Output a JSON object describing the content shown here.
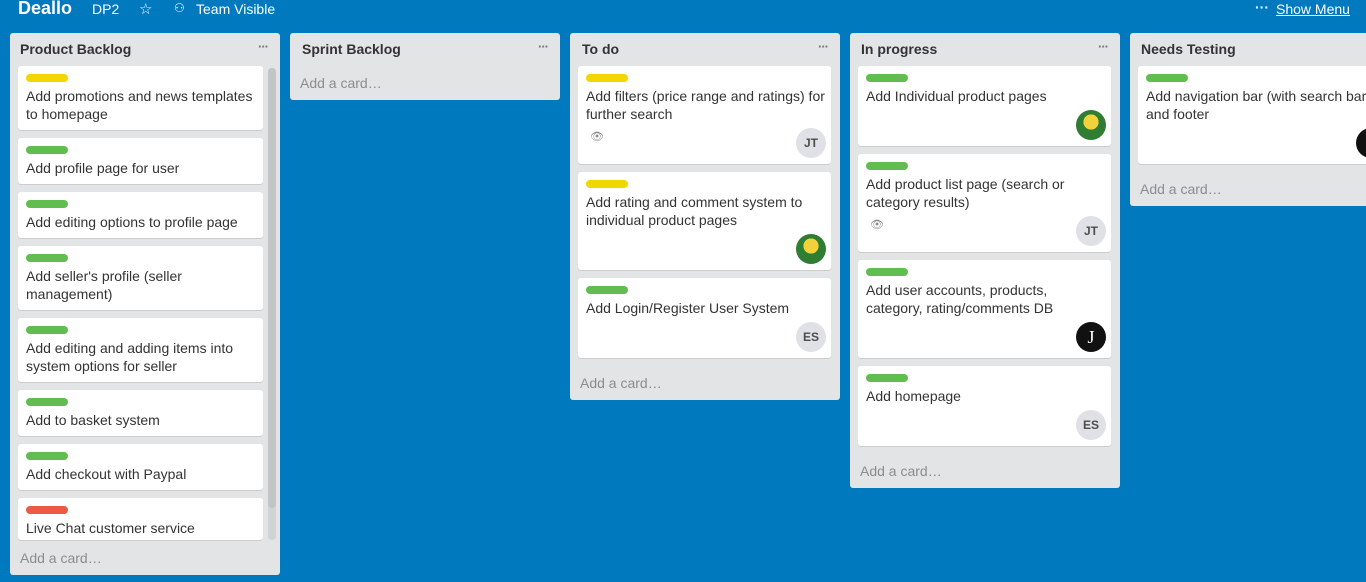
{
  "header": {
    "board_name": "Deallo",
    "board_tag": "DP2",
    "visibility": "Team Visible",
    "show_menu": "Show Menu"
  },
  "colors": {
    "green": "#61bd4f",
    "yellow": "#f2d600",
    "red": "#eb5a46"
  },
  "lists": [
    {
      "title": "Product Backlog",
      "add_card": "Add a card…",
      "cards": [
        {
          "label": "yellow",
          "title": "Add promotions and news templates to homepage"
        },
        {
          "label": "green",
          "title": "Add profile page for user"
        },
        {
          "label": "green",
          "title": "Add editing options to profile page"
        },
        {
          "label": "green",
          "title": "Add seller's profile (seller management)"
        },
        {
          "label": "green",
          "title": "Add editing and adding items into system options for seller"
        },
        {
          "label": "green",
          "title": "Add to basket system"
        },
        {
          "label": "green",
          "title": "Add checkout with Paypal"
        },
        {
          "label": "red",
          "title": "Live Chat customer service"
        }
      ]
    },
    {
      "title": "Sprint Backlog",
      "add_card": "Add a card…",
      "cards": []
    },
    {
      "title": "To do",
      "add_card": "Add a card…",
      "cards": [
        {
          "label": "yellow",
          "title": "Add filters (price range and ratings) for further search",
          "watch": true,
          "member": "JT"
        },
        {
          "label": "yellow",
          "title": "Add rating and comment system to individual product pages",
          "member_icon": "photo-avatar"
        },
        {
          "label": "green",
          "title": "Add Login/Register User System",
          "member": "ES"
        }
      ]
    },
    {
      "title": "In progress",
      "add_card": "Add a card…",
      "cards": [
        {
          "label": "green",
          "title": "Add Individual product pages",
          "member_icon": "photo-avatar"
        },
        {
          "label": "green",
          "title": "Add product list page (search or category results)",
          "watch": true,
          "member": "JT"
        },
        {
          "label": "green",
          "title": "Add user accounts, products, category, rating/comments DB",
          "member": "J"
        },
        {
          "label": "green",
          "title": "Add homepage",
          "member": "ES"
        }
      ]
    },
    {
      "title": "Needs Testing",
      "add_card": "Add a card…",
      "cards": [
        {
          "label": "green",
          "title": "Add navigation bar (with search bar) and footer",
          "member": "J"
        }
      ]
    }
  ]
}
